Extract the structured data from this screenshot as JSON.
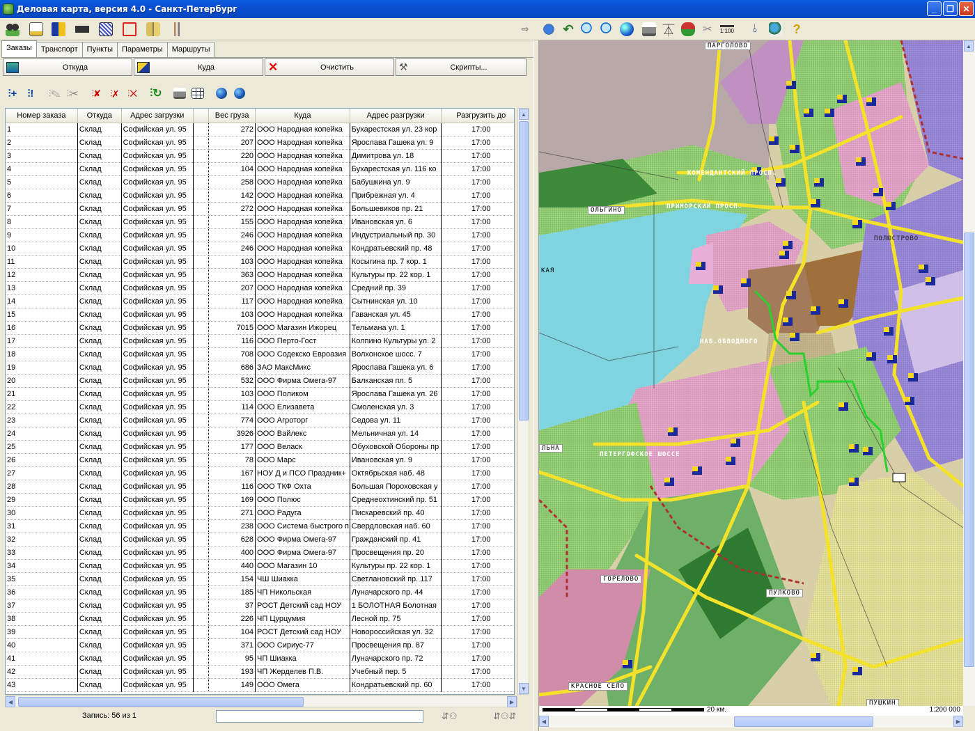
{
  "window": {
    "title": "Деловая карта, версия 4.0 - Санкт-Петербург",
    "minimize": "_",
    "maximize": "❐",
    "close": "✕"
  },
  "toolbar": {
    "scale_label": "1:100"
  },
  "tabs": [
    "Заказы",
    "Транспорт",
    "Пункты",
    "Параметры",
    "Маршруты"
  ],
  "commands": {
    "from": "Откуда",
    "to": "Куда",
    "clear": "Очистить",
    "scripts": "Скрипты..."
  },
  "table": {
    "columns": [
      "Номер заказа",
      "Откуда",
      "Адрес загрузки",
      "",
      "Вес груза",
      "Куда",
      "Адрес разгрузки",
      "Разгрузить до"
    ],
    "rows": [
      [
        "1",
        "Склад",
        "Софийская ул. 95",
        "272",
        "ООО Народная копейка",
        "Бухарестская ул. 23 кор",
        "17:00"
      ],
      [
        "2",
        "Склад",
        "Софийская ул. 95",
        "207",
        "ООО Народная копейка",
        "Ярослава Гашека ул. 9",
        "17:00"
      ],
      [
        "3",
        "Склад",
        "Софийская ул. 95",
        "220",
        "ООО Народная копейка",
        "Димитрова ул. 18",
        "17:00"
      ],
      [
        "4",
        "Склад",
        "Софийская ул. 95",
        "104",
        "ООО Народная копейка",
        "Бухарестская ул. 116 ко",
        "17:00"
      ],
      [
        "5",
        "Склад",
        "Софийская ул. 95",
        "258",
        "ООО Народная копейка",
        "Бабушкина ул. 9",
        "17:00"
      ],
      [
        "6",
        "Склад",
        "Софийская ул. 95",
        "142",
        "ООО Народная копейка",
        "Прибрежная ул. 4",
        "17:00"
      ],
      [
        "7",
        "Склад",
        "Софийская ул. 95",
        "272",
        "ООО Народная копейка",
        "Большевиков пр. 21",
        "17:00"
      ],
      [
        "8",
        "Склад",
        "Софийская ул. 95",
        "155",
        "ООО Народная копейка",
        "Ивановская ул. 6",
        "17:00"
      ],
      [
        "9",
        "Склад",
        "Софийская ул. 95",
        "246",
        "ООО Народная копейка",
        "Индустриальный пр. 30",
        "17:00"
      ],
      [
        "10",
        "Склад",
        "Софийская ул. 95",
        "246",
        "ООО Народная копейка",
        "Кондратьевский пр. 48",
        "17:00"
      ],
      [
        "11",
        "Склад",
        "Софийская ул. 95",
        "103",
        "ООО Народная копейка",
        "Косыгина пр. 7 кор. 1",
        "17:00"
      ],
      [
        "12",
        "Склад",
        "Софийская ул. 95",
        "363",
        "ООО Народная копейка",
        "Культуры пр. 22 кор. 1",
        "17:00"
      ],
      [
        "13",
        "Склад",
        "Софийская ул. 95",
        "207",
        "ООО Народная копейка",
        "Средний пр. 39",
        "17:00"
      ],
      [
        "14",
        "Склад",
        "Софийская ул. 95",
        "117",
        "ООО Народная копейка",
        "Сытнинская ул. 10",
        "17:00"
      ],
      [
        "15",
        "Склад",
        "Софийская ул. 95",
        "103",
        "ООО Народная копейка",
        "Гаванская ул. 45",
        "17:00"
      ],
      [
        "16",
        "Склад",
        "Софийская ул. 95",
        "7015",
        "ООО Магазин Ижорец",
        "Тельмана ул. 1",
        "17:00"
      ],
      [
        "17",
        "Склад",
        "Софийская ул. 95",
        "116",
        "ООО Перто-Гост",
        "Колпино Культуры ул. 2",
        "17:00"
      ],
      [
        "18",
        "Склад",
        "Софийская ул. 95",
        "708",
        "ООО Содекско Евроазия",
        "Волхонское шосс. 7",
        "17:00"
      ],
      [
        "19",
        "Склад",
        "Софийская ул. 95",
        "686",
        "ЗАО МаксМикс",
        "Ярослава Гашека ул. 6",
        "17:00"
      ],
      [
        "20",
        "Склад",
        "Софийская ул. 95",
        "532",
        "ООО Фирма Омега-97",
        "Балканская пл. 5",
        "17:00"
      ],
      [
        "21",
        "Склад",
        "Софийская ул. 95",
        "103",
        "ООО Поликом",
        "Ярослава Гашека ул. 26",
        "17:00"
      ],
      [
        "22",
        "Склад",
        "Софийская ул. 95",
        "114",
        "ООО Елизавета",
        "Смоленская ул. 3",
        "17:00"
      ],
      [
        "23",
        "Склад",
        "Софийская ул. 95",
        "774",
        "ООО Агроторг",
        "Седова ул. 11",
        "17:00"
      ],
      [
        "24",
        "Склад",
        "Софийская ул. 95",
        "3926",
        "ООО Вайлекс",
        "Мельничная ул. 14",
        "17:00"
      ],
      [
        "25",
        "Склад",
        "Софийская ул. 95",
        "177",
        "ООО Веласк",
        "Обуховской Обороны пр",
        "17:00"
      ],
      [
        "26",
        "Склад",
        "Софийская ул. 95",
        "78",
        "ООО Марс",
        "Ивановская ул. 9",
        "17:00"
      ],
      [
        "27",
        "Склад",
        "Софийская ул. 95",
        "167",
        "НОУ Д и ПСО Праздник+",
        "Октябрьская наб. 48",
        "17:00"
      ],
      [
        "28",
        "Склад",
        "Софийская ул. 95",
        "116",
        "ООО ТКФ Охта",
        "Большая Пороховская у",
        "17:00"
      ],
      [
        "29",
        "Склад",
        "Софийская ул. 95",
        "169",
        "ООО Полюс",
        "Среднеохтинский пр. 51",
        "17:00"
      ],
      [
        "30",
        "Склад",
        "Софийская ул. 95",
        "271",
        "ООО Радуга",
        "Пискаревский пр. 40",
        "17:00"
      ],
      [
        "31",
        "Склад",
        "Софийская ул. 95",
        "238",
        "ООО Система быстрого п",
        "Свердловская наб. 60",
        "17:00"
      ],
      [
        "32",
        "Склад",
        "Софийская ул. 95",
        "628",
        "ООО Фирма Омега-97",
        "Гражданский пр. 41",
        "17:00"
      ],
      [
        "33",
        "Склад",
        "Софийская ул. 95",
        "400",
        "ООО Фирма Омега-97",
        "Просвещения пр. 20",
        "17:00"
      ],
      [
        "34",
        "Склад",
        "Софийская ул. 95",
        "440",
        "ООО Магазин 10",
        "Культуры пр. 22 кор. 1",
        "17:00"
      ],
      [
        "35",
        "Склад",
        "Софийская ул. 95",
        "154",
        "ЧШ Шиакка",
        "Светлановский пр. 117",
        "17:00"
      ],
      [
        "36",
        "Склад",
        "Софийская ул. 95",
        "185",
        "ЧП  Никольская",
        "Луначарского пр. 44",
        "17:00"
      ],
      [
        "37",
        "Склад",
        "Софийская ул. 95",
        "37",
        "РОСТ Детский сад НОУ",
        "1 БОЛОТНАЯ Болотная",
        "17:00"
      ],
      [
        "38",
        "Склад",
        "Софийская ул. 95",
        "226",
        "ЧП Цурцумия",
        "Лесной пр. 75",
        "17:00"
      ],
      [
        "39",
        "Склад",
        "Софийская ул. 95",
        "104",
        "РОСТ Детский сад НОУ",
        "Новороссийская ул. 32",
        "17:00"
      ],
      [
        "40",
        "Склад",
        "Софийская ул. 95",
        "371",
        "ООО Сириус-77",
        "Просвещения пр. 87",
        "17:00"
      ],
      [
        "41",
        "Склад",
        "Софийская ул. 95",
        "95",
        "ЧП Шиакка",
        "Луначарского пр. 72",
        "17:00"
      ],
      [
        "42",
        "Склад",
        "Софийская ул. 95",
        "193",
        "ЧП Жерделев П.В.",
        "Учебный пер. 5",
        "17:00"
      ],
      [
        "43",
        "Склад",
        "Софийская ул. 95",
        "149",
        "ООО Омега",
        "Кондратьевский пр. 60",
        "17:00"
      ]
    ]
  },
  "status": {
    "records": "Запись: 56 из 1",
    "search_value": ""
  },
  "map": {
    "labels": [
      "ПАРГОЛОВО",
      "ОЛЬГИНО",
      "КОМЕНДАНТСКИЙ ПРОСП.",
      "ПРИМОРСКИЙ ПРОСП.",
      "ПОЛЮСТРОВО",
      "НАБ.ОБВОДНОГО",
      "ПЕТЕРГОФСКОЕ ШОССЕ",
      "ГОРЕЛОВО",
      "ПУЛКОВО",
      "КРАСНОЕ СЕЛО",
      "ПУШКИН",
      "ЛЬНА",
      "КАЯ"
    ],
    "scale_km": "20 км.",
    "scale_ratio": "1:200 000"
  }
}
